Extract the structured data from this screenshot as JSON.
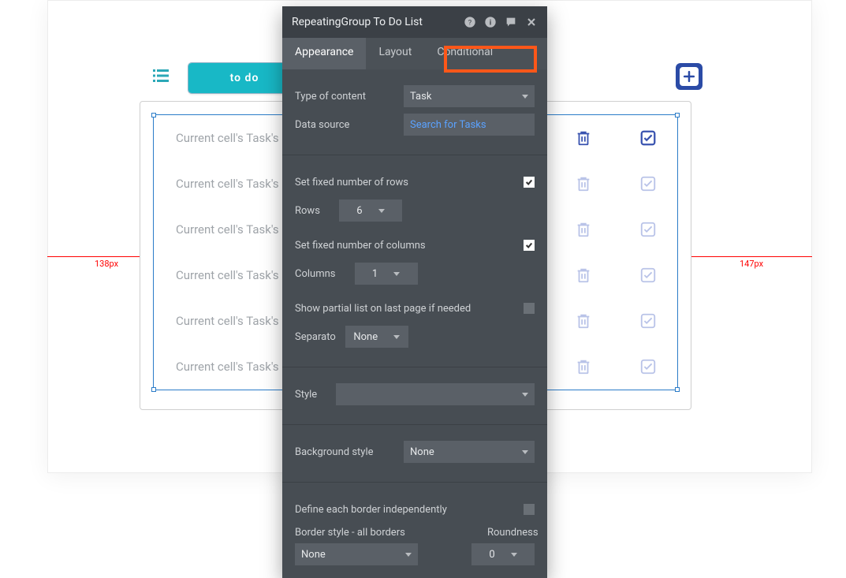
{
  "header": {
    "todo_label": "to do"
  },
  "guides": {
    "left_label": "138px",
    "right_label": "147px"
  },
  "rows": {
    "cell_text": "Current cell's Task's description",
    "count": 6
  },
  "panel": {
    "title": "RepeatingGroup To Do List",
    "tabs": {
      "appearance": "Appearance",
      "layout": "Layout",
      "conditional": "Conditional"
    },
    "type_of_content_label": "Type of content",
    "type_of_content_value": "Task",
    "data_source_label": "Data source",
    "data_source_value": "Search for Tasks",
    "fixed_rows_label": "Set fixed number of rows",
    "rows_label": "Rows",
    "rows_value": "6",
    "fixed_cols_label": "Set fixed number of columns",
    "cols_label": "Columns",
    "cols_value": "1",
    "partial_label": "Show partial list on last page if needed",
    "separator_label": "Separato",
    "separator_value": "None",
    "style_label": "Style",
    "bgstyle_label": "Background style",
    "bgstyle_value": "None",
    "border_indep_label": "Define each border independently",
    "border_style_label": "Border style - all borders",
    "border_style_value": "None",
    "roundness_label": "Roundness",
    "roundness_value": "0"
  }
}
